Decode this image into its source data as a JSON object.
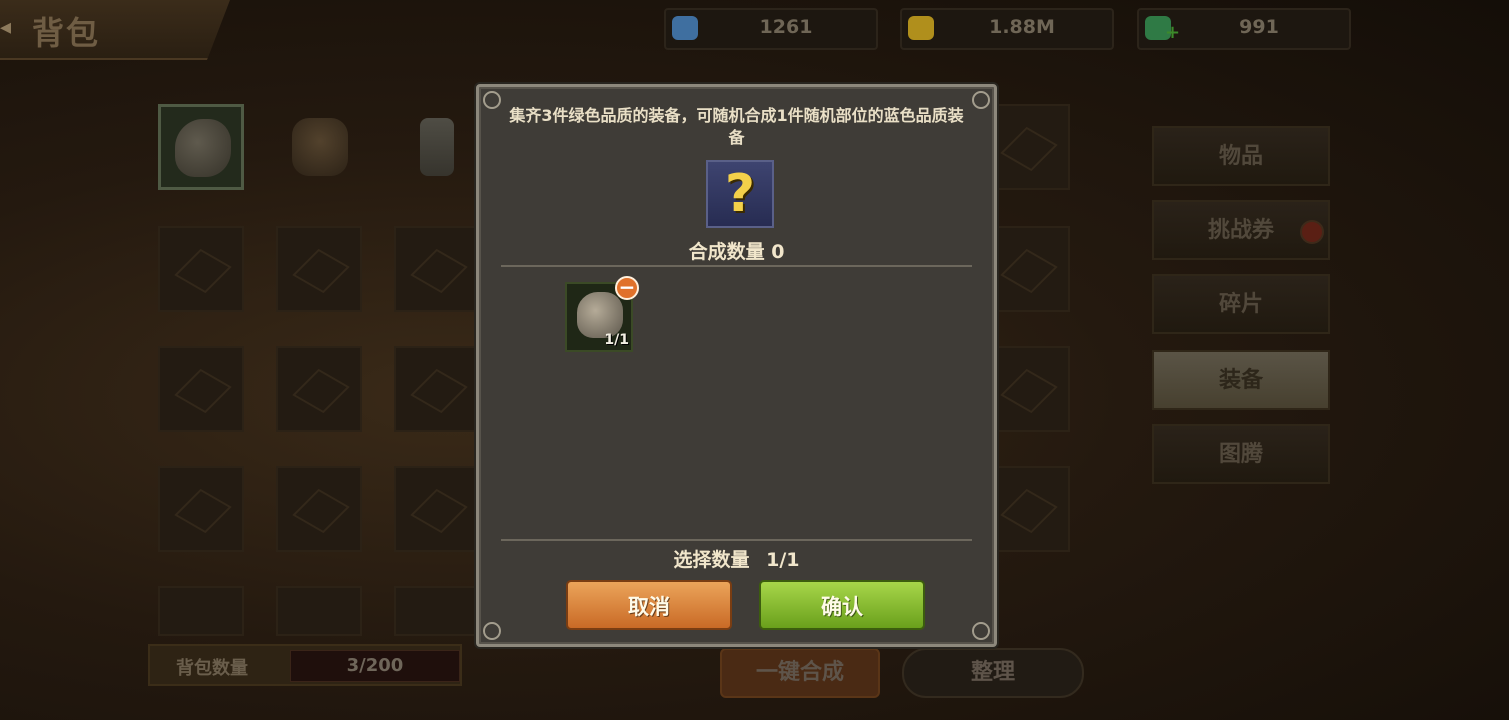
{
  "screen": {
    "title": "背包"
  },
  "resources": [
    {
      "icon": "gem-pile-icon",
      "value": "1261",
      "color": "#3f6fa0"
    },
    {
      "icon": "gold-ore-icon",
      "value": "1.88M",
      "color": "#b08f1c"
    },
    {
      "icon": "green-gem-plus-icon",
      "value": "991",
      "color": "#2f7a45"
    }
  ],
  "tabs": [
    {
      "label": "物品",
      "active": false,
      "dot": false
    },
    {
      "label": "挑战券",
      "active": false,
      "dot": true
    },
    {
      "label": "碎片",
      "active": false,
      "dot": false
    },
    {
      "label": "装备",
      "active": true,
      "dot": false
    },
    {
      "label": "图腾",
      "active": false,
      "dot": false
    }
  ],
  "bag": {
    "label": "背包数量",
    "value": "3/200"
  },
  "bottom_buttons": {
    "combine_all": "一键合成",
    "sort": "整理"
  },
  "dialog": {
    "description": "集齐3件绿色品质的装备，可随机合成1件随机部位的蓝色品质装备",
    "result_icon": "question-mark-icon",
    "combine_qty_label": "合成数量 0",
    "selected_item": {
      "icon": "claw-gauntlet-icon",
      "count": "1/1"
    },
    "select_qty_label": "选择数量",
    "select_qty_value": "1/1",
    "cancel": "取消",
    "confirm": "确认"
  }
}
